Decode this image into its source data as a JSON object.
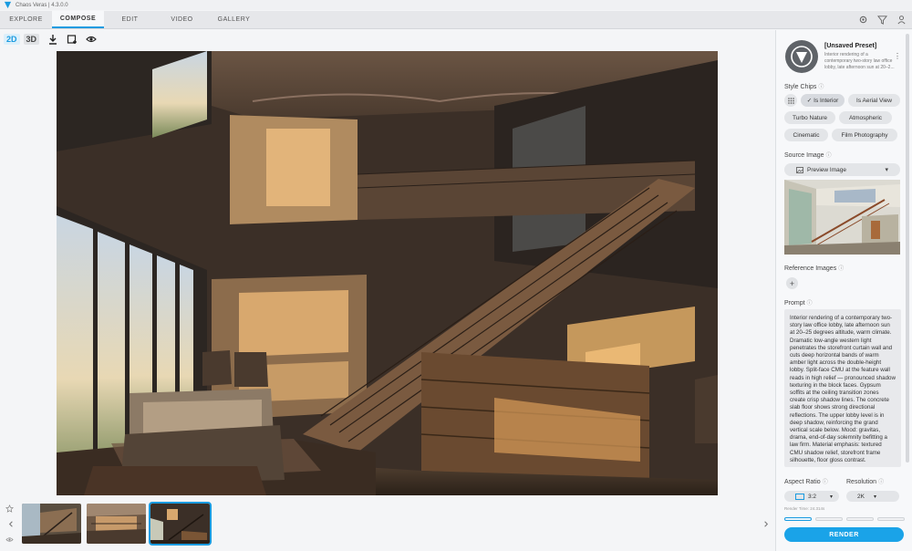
{
  "window": {
    "title": "Chaos Veras | 4.3.0.0"
  },
  "nav": {
    "tabs": [
      {
        "label": "EXPLORE"
      },
      {
        "label": "COMPOSE"
      },
      {
        "label": "EDIT"
      },
      {
        "label": "VIDEO"
      },
      {
        "label": "GALLERY"
      }
    ],
    "active_tab": "COMPOSE"
  },
  "toolbar": {
    "mode_2d": "2D",
    "mode_3d": "3D"
  },
  "preset": {
    "title": "[Unsaved Preset]",
    "description": "Interior rendering of a contemporary two-story law office lobby, late afternoon sun at 20–2..."
  },
  "style_chips": {
    "label": "Style Chips",
    "chips": [
      "Is Interior",
      "Is Aerial View",
      "Turbo Nature",
      "Atmospheric",
      "Cinematic",
      "Film Photography"
    ],
    "selected_check": "✓"
  },
  "source_image": {
    "label": "Source Image",
    "dropdown_value": "Preview Image"
  },
  "reference_images": {
    "label": "Reference Images",
    "add": "+"
  },
  "prompt": {
    "label": "Prompt",
    "text": "Interior rendering of a contemporary two-story law office lobby, late afternoon sun at 20–25 degrees altitude, warm climate. Dramatic low-angle western light penetrates the storefront curtain wall and cuts deep horizontal bands of warm amber light across the double-height lobby. Split-face CMU at the feature wall reads in high relief — pronounced shadow texturing in the block faces. Gypsum soffits at the ceiling transition zones create crisp shadow lines. The concrete slab floor shows strong directional reflections. The upper lobby level is in deep shadow, reinforcing the grand vertical scale below. Mood: gravitas, drama, end-of-day solemnity befitting a law firm. Material emphasis: textured CMU shadow relief, storefront frame silhouette, floor gloss contrast."
  },
  "aspect_ratio": {
    "label": "Aspect Ratio",
    "value": "3:2"
  },
  "resolution": {
    "label": "Resolution",
    "value": "2K"
  },
  "render_time": "Render Time: 24.314s",
  "render_progress": {
    "segments": 4,
    "active": 1
  },
  "render_button": "RENDER",
  "colors": {
    "accent": "#1aa3e8",
    "panel": "#f7f8fa",
    "nav": "#e6e7ea"
  }
}
